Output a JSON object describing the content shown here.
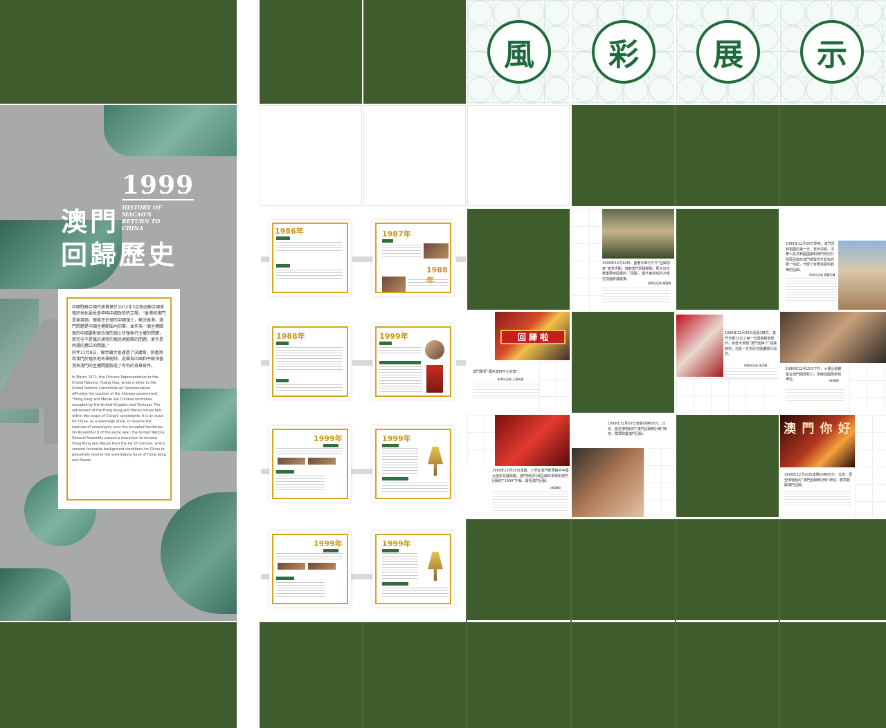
{
  "header": {
    "chars": [
      "風",
      "彩",
      "展",
      "示"
    ]
  },
  "banner": {
    "year": "1999",
    "title_line1": "澳門",
    "title_line2": "回歸歷史",
    "subtitle_en": "HISTORY OF MACAO'S RETURN TO CHINA",
    "para_cn_1": "中國駐聯合國代表黃華於1972年3月致函聯合國非殖民地化委員會申明中國政府的立場：“香港和澳門是被英國、葡萄牙佔領的中國領土，解決香港、澳門問題是中國主權範圍內的事，並作為一個主權國家的中國要對被佔領的領土所復執行主權的問題，而完全不是屬於通常的殖民地範疇的問題，更不是所謂的獨立的問題。”",
    "para_cn_2": "同年11月8日，聯合國大會通過了決議案，將香港和澳門於殖民地名單刪除，此舉為中國和平解決香港與澳門的主權問題製造了有利的背景條件。",
    "para_en": "In March 1972, the Chinese Representative to the United Nations, Huang Hua, wrote a letter to the United Nations Committee on Decolonization affirming the position of the Chinese government: \"Hong Kong and Macao are Chinese territories occupied by the United Kingdom and Portugal. The settlement of the Hong Kong and Macao issues falls within the scope of China's sovereignty. It is an issue for China, as a sovereign state, to resume the exercise of sovereignty over the occupied territories. On November 8 of the same year, the United Nations General Assembly passed a resolution to remove Hong Kong and Macao from the list of colonies, which created favorable background conditions for China to peacefully resolve the sovereignty issue of Hong Kong and Macao."
  },
  "timeline": {
    "cards": [
      {
        "year": "1986年"
      },
      {
        "year": "1987年",
        "year2": "1988年"
      },
      {
        "year": "1988年"
      },
      {
        "year": "1999年"
      },
      {
        "year": "1999年"
      },
      {
        "year": "1999年"
      },
      {
        "year": "1999年"
      },
      {
        "year": "1999年"
      }
    ]
  },
  "photos": {
    "p1_caption": "1999年12月19日，盛著手舉行千平“回歸前奏”慈濟活動，遊龍澳門回歸期間，那天台年數重要時段慶的「月圓」，慶代東檢成的方報在前面影議結束。",
    "p1_credit": "香港社記者 趙勤攝",
    "p2_caption": "1999年12月20日零時，澳門回歸祖國的第一天，當天清晨，中華人民共和國國旗和澳門特別行政區區旗在澳門禮賓府升起後的那一刻起，代號了有著自豪和歡樂的回歸。",
    "p2_credit": "香港社記者 蔡麗芳攝",
    "p3_caption": "澳門慶祝“國內澳好可大迎澳”。",
    "p3_credit": "新華社記者 王建新攝",
    "p3_sign": "回 歸 啦",
    "p4_caption": "1999年12月20日清晨1時許，澳門日報11位了第一份回歸報道號外。就發大標題“澳門回歸了”迎接時刻，這是一位市民在閱讀號外消息。",
    "p4_credit": "新華社記者 張洪攝",
    "p5_caption": "1999年12月15日下午，大量記者聚集在澳門碼頭新口，準確與國際新聞單位。",
    "p5_credit": "(新華攝)",
    "p6_caption": "1999年12月20日凌晨，人們在澳門新馬路手中國大陸彩化議政廳，澳門特別行政區旗的事務和澳門回歸的“1999”字幕，慶祝澳門回歸。",
    "p6_credit": "(新華攝)",
    "p7_caption": "1999年12月20日凌晨00時05分，北京，歷史博物館的“澳門回歸倒計時”牌前，群眾歡慶澳門回歸。",
    "p8_caption": "1999年12月20日凌晨00時05分，北京，歷史博物館的“澳門回歸倒計時”牌前，群眾歡慶澳門回歸。",
    "p8_sign": "澳 門 你 好"
  },
  "colors": {
    "green": "#3f5c2d",
    "gold": "#d7a21c",
    "teal": "#1f6b3c"
  }
}
